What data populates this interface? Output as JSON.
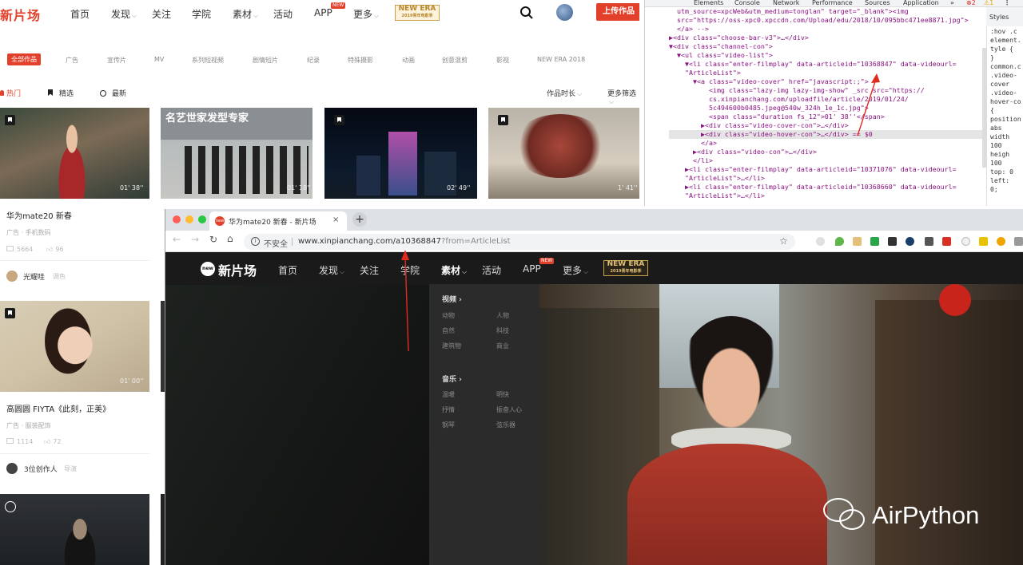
{
  "site": {
    "logo": "新片场",
    "nav": [
      "首页",
      "发现",
      "关注",
      "学院",
      "素材",
      "活动",
      "APP",
      "更多"
    ],
    "app_badge": "NEW",
    "newera_line1": "NEW ERA",
    "newera_line2": "2019青年电影季",
    "upload": "上传作品",
    "categories": [
      "全部作品",
      "广告",
      "宣传片",
      "MV",
      "系列短视频",
      "剧情短片",
      "纪录",
      "特殊摄影",
      "动画",
      "创意混剪",
      "影视",
      "NEW ERA 2018"
    ],
    "sort_tabs": [
      "热门",
      "精选",
      "最新"
    ],
    "filters": [
      "作品时长",
      "更多筛选"
    ],
    "cards": [
      {
        "duration": "01' 38''",
        "title": "华为mate20 新春",
        "sub": "广告 · 手机数码",
        "views": "5664",
        "likes": "96",
        "author": "光耀哇",
        "role": "调色"
      },
      {
        "duration": "01' 18''",
        "sign": "名艺世家发型专家"
      },
      {
        "duration": "02' 49''"
      },
      {
        "duration": "1' 41''"
      },
      {
        "duration": "01' 00''",
        "title": "高圆圆 FIYTA《此刻，正美》",
        "sub": "广告 · 服装配饰",
        "views": "1114",
        "likes": "72",
        "author": "3位创作人",
        "role": "导演"
      }
    ]
  },
  "devtools": {
    "tabs": [
      "Elements",
      "Console",
      "Network",
      "Performance",
      "Sources",
      "Application",
      "»"
    ],
    "errors": "2",
    "warnings": "1",
    "styles_tab": "Styles",
    "styles_lines": [
      ":hov .c",
      "element.",
      "tyle {",
      "}",
      "common.c",
      ".video-",
      "cover",
      ".video-",
      "hover-co",
      "{",
      "position",
      "abs",
      "width",
      "100",
      "heigh",
      "100",
      "top: 0",
      "left:",
      "0;"
    ],
    "code": [
      "  utm_source=xpcWeb&utm_medium=tonglan\" target=\"_blank\"><img",
      "  src=\"https://oss-xpc0.xpccdn.com/Upload/edu/2018/10/095bbc471ee8871.jpg\">",
      "  </a> -->",
      "▶<div class=\"choose-bar-v3\">…</div>",
      "▼<div class=\"channel-con\">",
      "  ▼<ul class=\"video-list\">",
      "    ▼<li class=\"enter-filmplay\" data-articleid=\"10368847\" data-videourl=",
      "    \"ArticleList\">",
      "      ▼<a class=\"video-cover\" href=\"javascript:;\">",
      "          <img class=\"lazy-img lazy-img-show\" _src src=\"https://",
      "          cs.xinpianchang.com/uploadfile/article/2019/01/24/",
      "          5c494600b0485.jpeg@540w_324h_1e_1c.jpg\">",
      "          <span class=\"duration fs_12\">01' 38''</span>",
      "        ▶<div class=\"video-cover-con\">…</div>",
      "        ▶<div class=\"video-hover-con\">…</div> == $0",
      "        </a>",
      "      ▶<div class=\"video-con\">…</div>",
      "      </li>",
      "    ▶<li class=\"enter-filmplay\" data-articleid=\"10371076\" data-videourl=",
      "    \"ArticleList\">…</li>",
      "    ▶<li class=\"enter-filmplay\" data-articleid=\"10368660\" data-videourl=",
      "    \"ArticleList\">…</li>"
    ]
  },
  "browser": {
    "tab_title": "华为mate20 新春 - 新片场",
    "insecure": "不安全",
    "url_host": "www.xinpianchang.com/a10368847",
    "url_query": "?from=ArticleList",
    "logo": "新片场",
    "nav": [
      "首页",
      "发现",
      "关注",
      "学院",
      "素材",
      "活动",
      "APP",
      "更多"
    ],
    "app_badge": "NEW",
    "newera_line1": "NEW ERA",
    "newera_line2": "2019青年电影季",
    "dropdown": {
      "video_head": "视频 ›",
      "video_items": [
        "动物",
        "人物",
        "自然",
        "科技",
        "建筑物",
        "商业"
      ],
      "music_head": "音乐 ›",
      "music_items": [
        "温暖",
        "明快",
        "抒情",
        "振奋人心",
        "钢琴",
        "弦乐器"
      ]
    }
  },
  "watermark": "AirPython",
  "colors": {
    "brand": "#e2402a",
    "annotation": "#e02b20"
  }
}
